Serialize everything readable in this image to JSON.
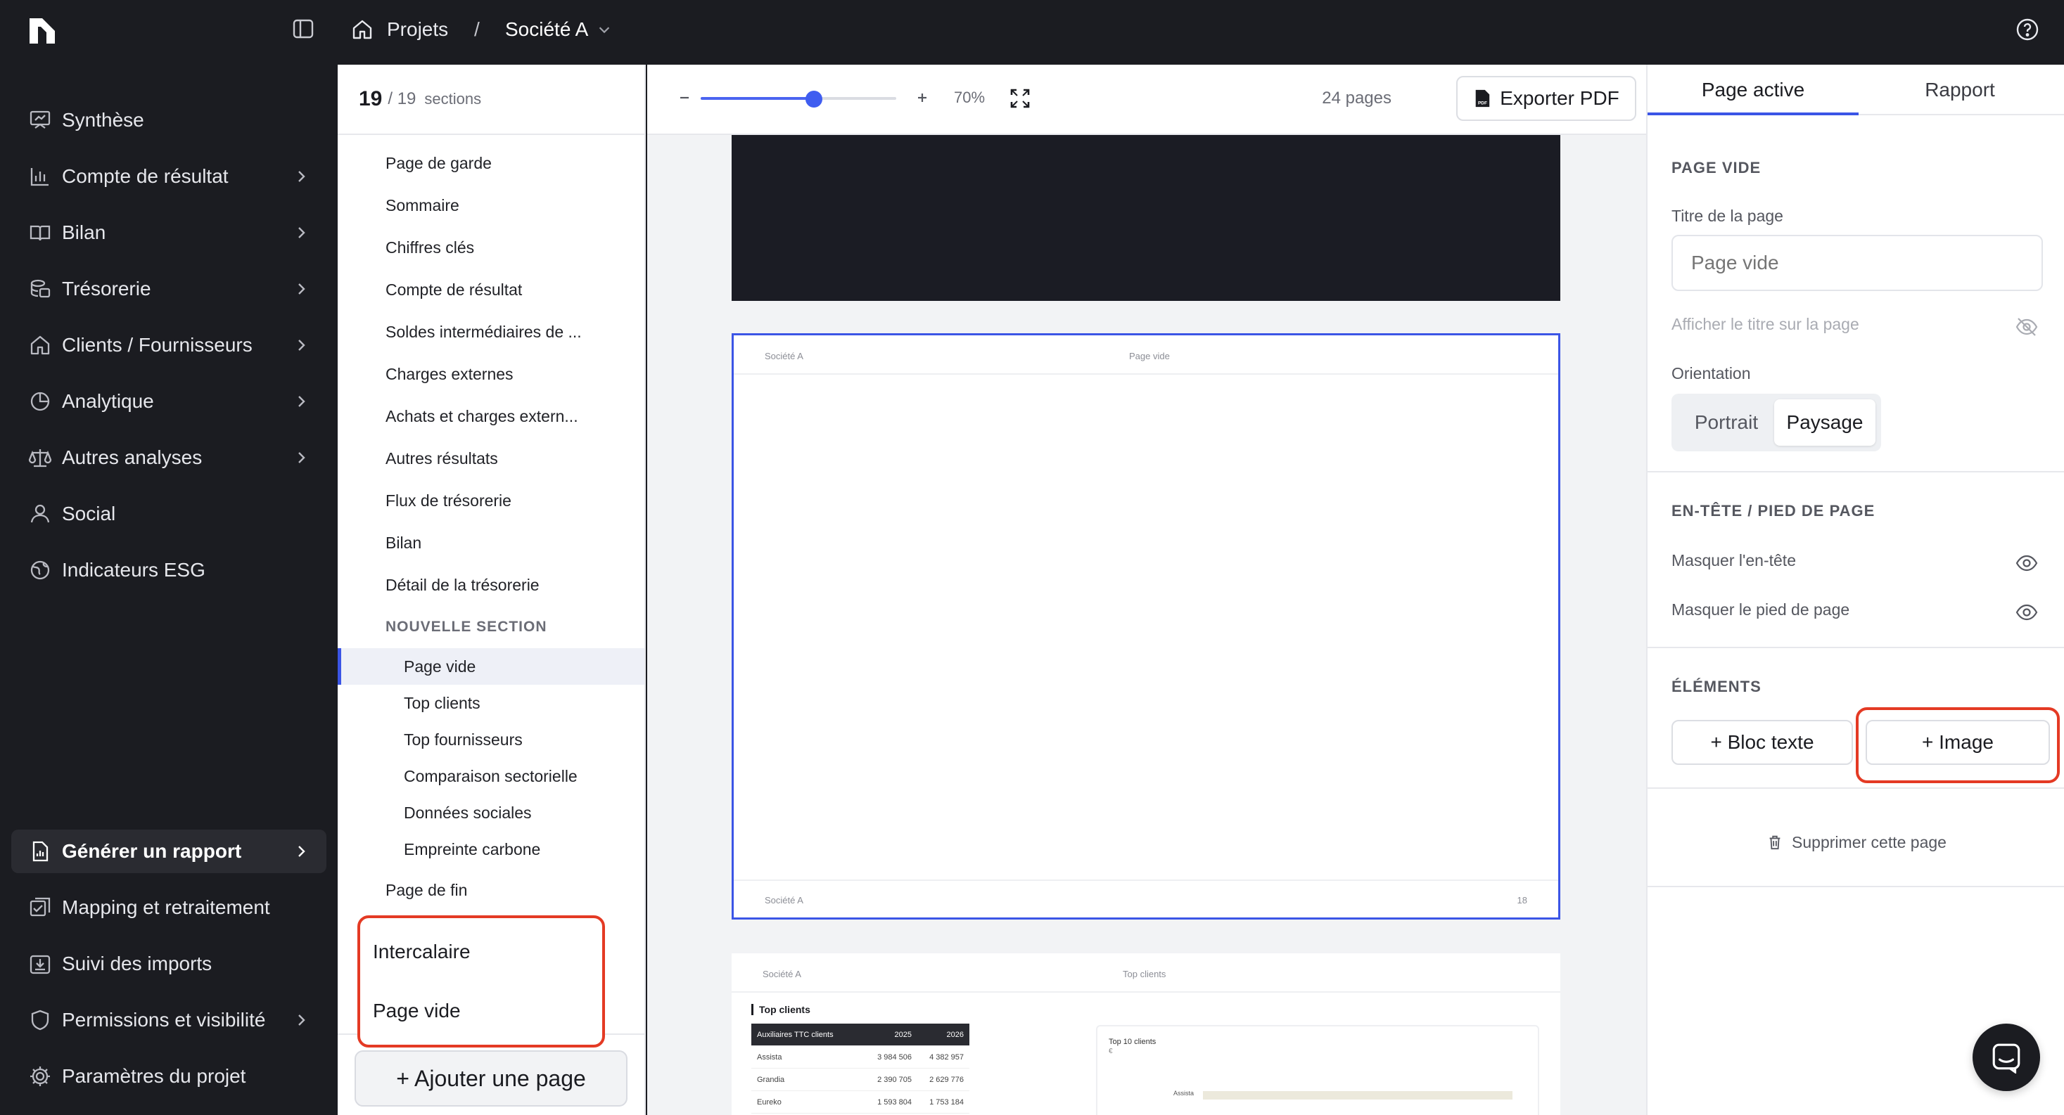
{
  "header": {
    "breadcrumb_home": "Projets",
    "breadcrumb_separator": "/",
    "breadcrumb_company": "Société A"
  },
  "nav": {
    "items": [
      {
        "label": "Synthèse",
        "icon": "presentation-icon"
      },
      {
        "label": "Compte de résultat",
        "icon": "bar-chart-icon"
      },
      {
        "label": "Bilan",
        "icon": "book-icon"
      },
      {
        "label": "Trésorerie",
        "icon": "coins-icon"
      },
      {
        "label": "Clients / Fournisseurs",
        "icon": "home-icon"
      },
      {
        "label": "Analytique",
        "icon": "pie-chart-icon"
      },
      {
        "label": "Autres analyses",
        "icon": "scale-icon"
      },
      {
        "label": "Social",
        "icon": "user-icon"
      },
      {
        "label": "Indicateurs ESG",
        "icon": "globe-icon"
      },
      {
        "label": "Générer un rapport",
        "icon": "report-icon"
      },
      {
        "label": "Mapping et retraitement",
        "icon": "mapping-icon"
      },
      {
        "label": "Suivi des imports",
        "icon": "import-icon"
      },
      {
        "label": "Permissions et visibilité",
        "icon": "shield-icon"
      },
      {
        "label": "Paramètres du projet",
        "icon": "gear-icon"
      }
    ],
    "active": "Générer un rapport"
  },
  "sections": {
    "count": "19",
    "total": "/ 19",
    "word": "sections",
    "items": [
      "Page de garde",
      "Sommaire",
      "Chiffres clés",
      "Compte de résultat",
      "Soldes intermédiaires de ...",
      "Charges externes",
      "Achats et charges extern...",
      "Autres résultats",
      "Flux de trésorerie",
      "Bilan",
      "Détail de la trésorerie"
    ],
    "group_heading": "NOUVELLE SECTION",
    "group_items": [
      "Page vide",
      "Top clients",
      "Top fournisseurs",
      "Comparaison sectorielle",
      "Données sociales",
      "Empreinte carbone"
    ],
    "active_item": "Page vide",
    "last_item": "Page de fin",
    "dropdown": [
      "Intercalaire",
      "Page vide"
    ],
    "add_button": "+ Ajouter une page"
  },
  "toolbar": {
    "zoom_minus": "−",
    "zoom_plus": "+",
    "zoom_value": "70%",
    "zoom_fraction": 0.58,
    "page_count": "24 pages",
    "export_label": "Exporter PDF",
    "export_icon_text": "PDF"
  },
  "preview": {
    "current_page": {
      "header_left": "Société A",
      "header_center": "Page vide",
      "footer_left": "Société A",
      "footer_right": "18"
    },
    "next_page": {
      "header_left": "Société A",
      "header_center": "Top clients",
      "section_title": "Top clients",
      "table_headers": [
        "Auxiliaires TTC clients",
        "2025",
        "2026"
      ],
      "table_rows": [
        [
          "Assista",
          "3 984 506",
          "4 382 957"
        ],
        [
          "Grandia",
          "2 390 705",
          "2 629 776"
        ],
        [
          "Eureko",
          "1 593 804",
          "1 753 184"
        ]
      ],
      "chart_title": "Top 10 clients",
      "chart_unit": "€",
      "chart_category": "Assista"
    }
  },
  "props": {
    "tabs": [
      "Page active",
      "Rapport"
    ],
    "active_tab": "Page active",
    "section_page": "PAGE VIDE",
    "title_label": "Titre de la page",
    "title_placeholder": "Page vide",
    "show_title_label": "Afficher le titre sur la page",
    "orientation_label": "Orientation",
    "orientation_options": [
      "Portrait",
      "Paysage"
    ],
    "orientation_selected": "Paysage",
    "section_header_footer": "EN-TÊTE / PIED DE PAGE",
    "hide_header": "Masquer l'en-tête",
    "hide_footer": "Masquer le pied de page",
    "section_elements": "ÉLÉMENTS",
    "add_text_block": "+ Bloc texte",
    "add_image": "+ Image",
    "delete_page": "Supprimer cette page"
  },
  "colors": {
    "accent": "#3b55e6",
    "highlight": "#e43a24",
    "nav_bg": "#1b1c21"
  }
}
